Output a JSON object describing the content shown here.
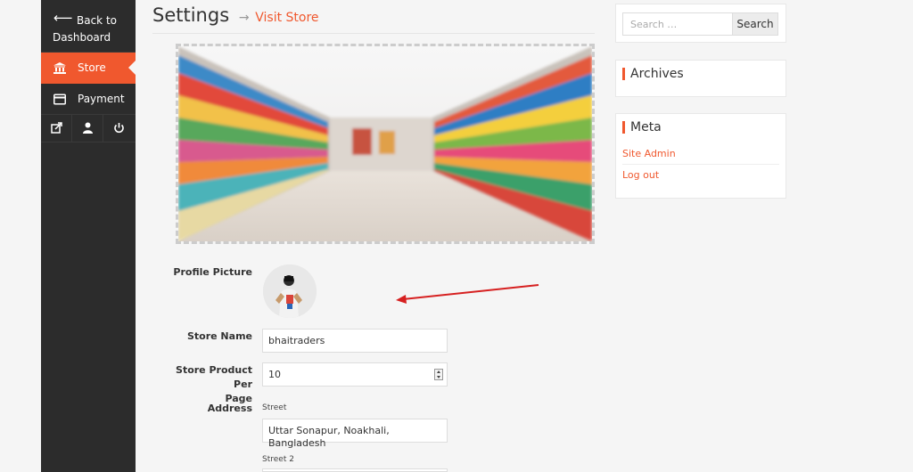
{
  "sidebar": {
    "back_line1": "Back to",
    "back_line2": "Dashboard",
    "items": [
      {
        "label": "Store",
        "icon": "bank-icon",
        "active": true
      },
      {
        "label": "Payment",
        "icon": "credit-card-icon",
        "active": false
      }
    ],
    "icon_row": [
      "external-link-icon",
      "user-icon",
      "power-icon"
    ],
    "accent_color": "#f0582e"
  },
  "page": {
    "title": "Settings",
    "arrow": "→",
    "visit_store": "Visit Store"
  },
  "form": {
    "profile_picture_label": "Profile Picture",
    "store_name_label": "Store Name",
    "store_name_value": "bhaitraders",
    "per_page_label_1": "Store Product Per",
    "per_page_label_2": "Page",
    "per_page_value": "10",
    "address_label": "Address",
    "street_label": "Street",
    "street_value": "Uttar Sonapur, Noakhali, Bangladesh",
    "street2_label": "Street 2"
  },
  "widgets": {
    "search_placeholder": "Search …",
    "search_button": "Search",
    "archives_title": "Archives",
    "meta_title": "Meta",
    "meta_links": [
      "Site Admin",
      "Log out"
    ]
  }
}
